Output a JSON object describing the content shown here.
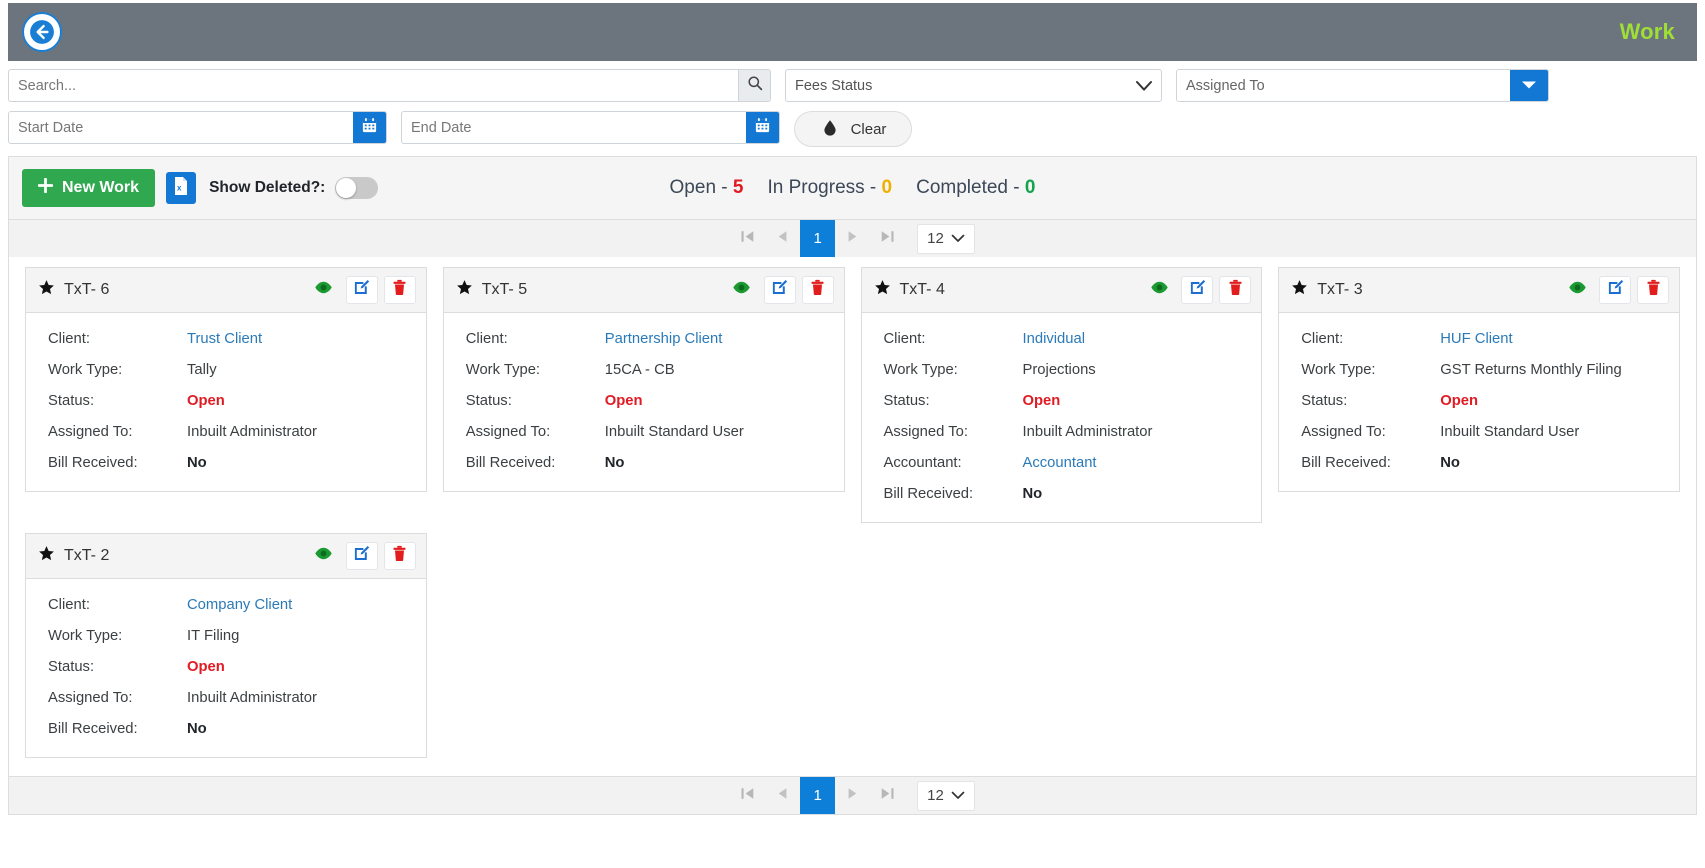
{
  "appbar": {
    "back_icon": "back-arrow-icon",
    "title": "Work"
  },
  "filters": {
    "search_placeholder": "Search...",
    "search_value": "",
    "search_icon": "search-icon",
    "fees_status": {
      "selected": "Fees Status",
      "options": [
        "Fees Status"
      ],
      "caret_icon": "chevron-down-icon"
    },
    "assigned_to": {
      "placeholder": "Assigned To",
      "value": "",
      "caret_icon": "caret-down-icon"
    },
    "start_date": {
      "placeholder": "Start Date",
      "value": "",
      "icon": "calendar-icon"
    },
    "end_date": {
      "placeholder": "End Date",
      "value": "",
      "icon": "calendar-icon"
    },
    "clear": {
      "label": "Clear",
      "icon": "eraser-icon"
    }
  },
  "toolbar": {
    "new_work_label": "New Work",
    "new_work_icon": "plus-icon",
    "excel_icon": "excel-export-icon",
    "show_deleted_label": "Show Deleted?:",
    "show_deleted_state": "off",
    "counts": {
      "open_label": "Open - ",
      "open_value": "5",
      "in_progress_label": "In Progress - ",
      "in_progress_value": "0",
      "completed_label": "Completed - ",
      "completed_value": "0"
    }
  },
  "pager": {
    "first_icon": "first-page-icon",
    "prev_icon": "previous-page-icon",
    "next_icon": "next-page-icon",
    "last_icon": "last-page-icon",
    "current_page": "1",
    "page_size": "12",
    "page_size_caret": "chevron-down-icon"
  },
  "colors": {
    "appbar_bg": "#6c757d",
    "title_green": "#9ede37",
    "primary_blue": "#1278d4",
    "new_work_green": "#2fa84f",
    "status_open_red": "#e01b24",
    "in_progress_amber": "#f0b000",
    "completed_green": "#14a44d",
    "link_blue": "#2a7ab9"
  },
  "card_labels": {
    "client": "Client:",
    "work_type": "Work Type:",
    "status": "Status:",
    "assigned_to": "Assigned To:",
    "accountant": "Accountant:",
    "bill_received": "Bill Received:"
  },
  "card_icons": {
    "star": "star-icon",
    "view": "eye-icon",
    "edit": "edit-pencil-icon",
    "delete": "trash-icon"
  },
  "cards": [
    {
      "title": "TxT- 6",
      "client": "Trust Client",
      "work_type": "Tally",
      "status": "Open",
      "assigned_to": "Inbuilt Administrator",
      "accountant": null,
      "bill_received": "No"
    },
    {
      "title": "TxT- 5",
      "client": "Partnership Client",
      "work_type": "15CA - CB",
      "status": "Open",
      "assigned_to": "Inbuilt Standard User",
      "accountant": null,
      "bill_received": "No"
    },
    {
      "title": "TxT- 4",
      "client": "Individual",
      "work_type": "Projections",
      "status": "Open",
      "assigned_to": "Inbuilt Administrator",
      "accountant": "Accountant",
      "bill_received": "No"
    },
    {
      "title": "TxT- 3",
      "client": "HUF Client",
      "work_type": "GST Returns Monthly Filing",
      "status": "Open",
      "assigned_to": "Inbuilt Standard User",
      "accountant": null,
      "bill_received": "No"
    },
    {
      "title": "TxT- 2",
      "client": "Company Client",
      "work_type": "IT Filing",
      "status": "Open",
      "assigned_to": "Inbuilt Administrator",
      "accountant": null,
      "bill_received": "No"
    }
  ]
}
